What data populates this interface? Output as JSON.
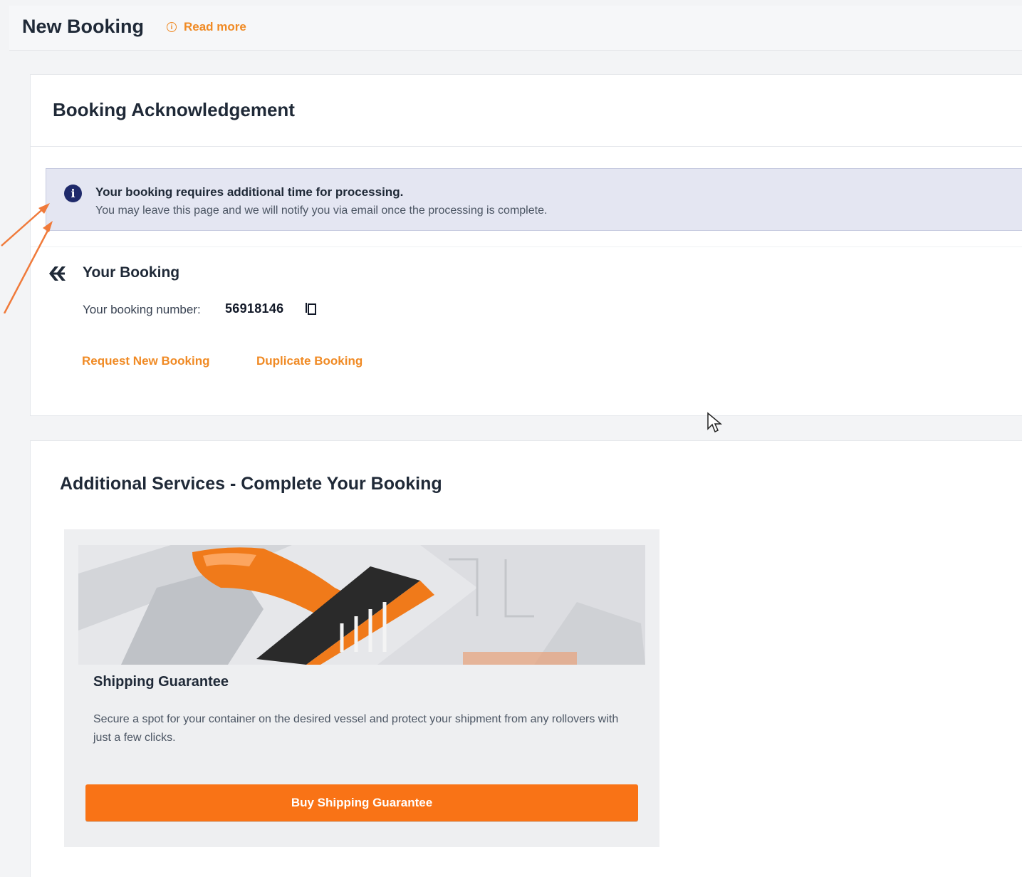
{
  "header": {
    "title": "New Booking",
    "read_more": "Read more"
  },
  "acknowledgement": {
    "title": "Booking Acknowledgement",
    "notice": {
      "title": "Your booking requires additional time for processing.",
      "text": "You may leave this page and we will notify you via email once the processing is complete."
    },
    "your_booking": {
      "title": "Your Booking",
      "number_label": "Your booking number:",
      "number": "56918146"
    },
    "links": {
      "request_new": "Request New Booking",
      "duplicate": "Duplicate Booking"
    }
  },
  "additional_services": {
    "title": "Additional Services - Complete Your Booking",
    "card": {
      "title": "Shipping Guarantee",
      "description": "Secure a spot for your container on the desired vessel and protect your shipment from any rollovers with just a few clicks.",
      "button": "Buy Shipping Guarantee"
    }
  },
  "colors": {
    "accent": "#f08a24",
    "button": "#f97316",
    "notice_bg": "#e4e6f2",
    "notice_icon": "#1f2a6b"
  },
  "icons": [
    "info-icon",
    "brand-logo-icon",
    "copy-icon",
    "annotation-arrow",
    "mouse-cursor"
  ]
}
